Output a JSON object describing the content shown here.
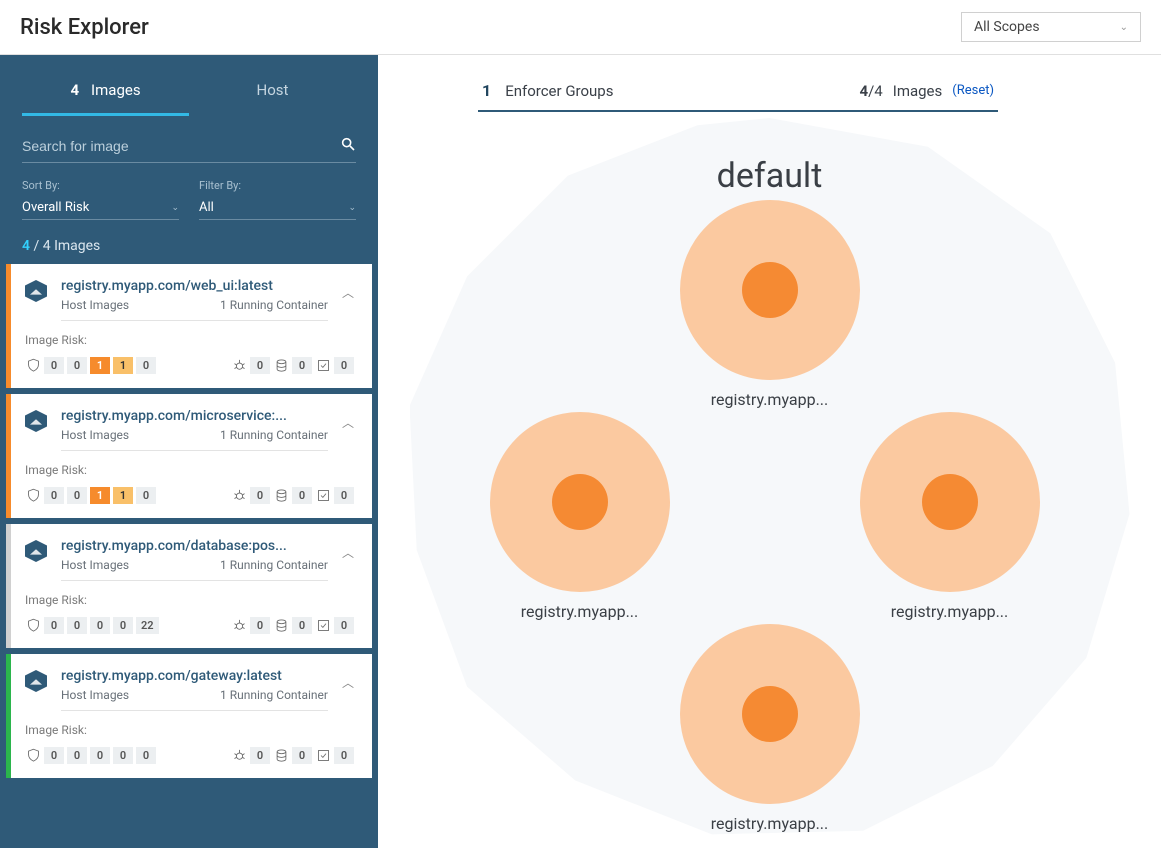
{
  "header": {
    "title": "Risk Explorer",
    "scope": "All Scopes"
  },
  "sidebar": {
    "tabs": {
      "images": {
        "count": "4",
        "label": "Images"
      },
      "host": {
        "label": "Host"
      }
    },
    "search_placeholder": "Search for image",
    "sort_label": "Sort By:",
    "sort_value": "Overall Risk",
    "filter_label": "Filter By:",
    "filter_value": "All",
    "counter_highlight": "4",
    "counter_rest": " / 4 Images",
    "risk_label": "Image Risk:",
    "cards": [
      {
        "state": "orange",
        "title": "registry.myapp.com/web_ui:latest",
        "sub_left": "Host Images",
        "sub_right": "1 Running Container",
        "vulns": [
          "0",
          "0",
          "1",
          "1",
          "0"
        ],
        "vuln_classes": [
          "",
          "",
          "or1",
          "or2",
          ""
        ],
        "m1": "0",
        "m2": "0",
        "m3": "0"
      },
      {
        "state": "orange",
        "title": "registry.myapp.com/microservice:...",
        "sub_left": "Host Images",
        "sub_right": "1 Running Container",
        "vulns": [
          "0",
          "0",
          "1",
          "1",
          "0"
        ],
        "vuln_classes": [
          "",
          "",
          "or1",
          "or2",
          ""
        ],
        "m1": "0",
        "m2": "0",
        "m3": "0"
      },
      {
        "state": "gray",
        "title": "registry.myapp.com/database:pos...",
        "sub_left": "Host Images",
        "sub_right": "1 Running Container",
        "vulns": [
          "0",
          "0",
          "0",
          "0",
          "22"
        ],
        "vuln_classes": [
          "",
          "",
          "",
          "",
          ""
        ],
        "m1": "0",
        "m2": "0",
        "m3": "0"
      },
      {
        "state": "green",
        "title": "registry.myapp.com/gateway:latest",
        "sub_left": "Host Images",
        "sub_right": "1 Running Container",
        "vulns": [
          "0",
          "0",
          "0",
          "0",
          "0"
        ],
        "vuln_classes": [
          "",
          "",
          "",
          "",
          ""
        ],
        "m1": "0",
        "m2": "0",
        "m3": "0"
      }
    ]
  },
  "panel": {
    "groups_n": "1",
    "groups_label": "Enforcer Groups",
    "images_n": "4",
    "images_total": "/4",
    "images_label": "Images",
    "reset": "(Reset)",
    "viz_title": "default",
    "nodes": {
      "n1": "registry.myapp...",
      "n2": "registry.myapp...",
      "n3": "registry.myapp...",
      "n4": "registry.myapp..."
    }
  }
}
